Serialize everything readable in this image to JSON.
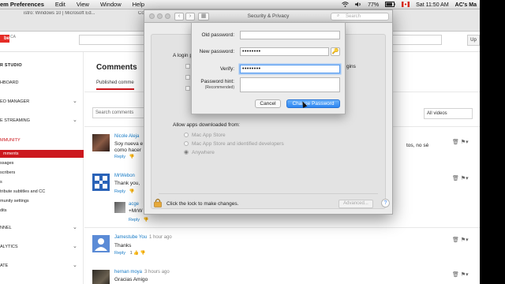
{
  "menubar": {
    "app_name": "em Preferences",
    "items": [
      "Edit",
      "View",
      "Window",
      "Help"
    ],
    "battery": "77%",
    "clock": "Sat 11:50 AM",
    "user": "AC's Ma"
  },
  "browser": {
    "tab_text": "istro: Windows 10 | Microsoft Ed...",
    "tab_text_2": "Co",
    "upload_label": "Up"
  },
  "leftnav": {
    "studio": "R STUDIO",
    "dashboard": "HBOARD",
    "video_manager": "EO MANAGER",
    "live_streaming": "E STREAMING",
    "community": "MMUNITY",
    "comments": "mments",
    "messages": "ssages",
    "subscribers": "scribers",
    "s": "s",
    "subtitles": "tribute subtitles and CC",
    "community_settings": "munity settings",
    "its": "dits",
    "channel": "NNEL",
    "analytics": "ALYTICS",
    "create": "ATE",
    "ca": "CA"
  },
  "main": {
    "title": "Comments",
    "tab_published": "Published comme",
    "search_placeholder": "Search comments",
    "filter": "All videos",
    "comments": [
      {
        "author": "Nicole Aleja",
        "time": "",
        "text1": "Soy nueva e",
        "text2": "como hacer",
        "right_text": "tos, no sé",
        "reply": "Reply"
      },
      {
        "author": "MrWebon",
        "time": "",
        "text1": "Thank you,",
        "text2": "",
        "reply": "Reply"
      },
      {
        "author": "acge",
        "time": "",
        "text1": "+MrW",
        "text2": "",
        "reply": "Reply"
      },
      {
        "author": "Jamestube You",
        "time": "1 hour ago",
        "text1": "Thanks",
        "text2": "",
        "reply": "Reply",
        "likes": "1"
      },
      {
        "author": "hernan moya",
        "time": "3 hours ago",
        "text1": "Gracias Amigo",
        "text2": "",
        "reply": ""
      }
    ]
  },
  "dialog": {
    "title": "Security & Privacy",
    "search_placeholder": "Search",
    "login_label": "A login p",
    "logins_label": "gins",
    "allow_label": "Allow apps downloaded from:",
    "options": [
      "Mac App Store",
      "Mac App Store and identified developers",
      "Anywhere"
    ],
    "selected_option": "Anywhere",
    "lock_text": "Click the lock to make changes.",
    "advanced_label": "Advanced...",
    "help_label": "?"
  },
  "sheet": {
    "old_label": "Old password:",
    "new_label": "New password:",
    "new_value": "••••••••",
    "verify_label": "Verify:",
    "verify_value": "••••••••",
    "hint_label": "Password hint:",
    "hint_sub": "(Recommended)",
    "cancel_label": "Cancel",
    "change_label": "Change Password"
  },
  "colors": {
    "youtube_red": "#cc181e",
    "link_blue": "#167ac6",
    "mac_blue": "#2c86f2"
  }
}
